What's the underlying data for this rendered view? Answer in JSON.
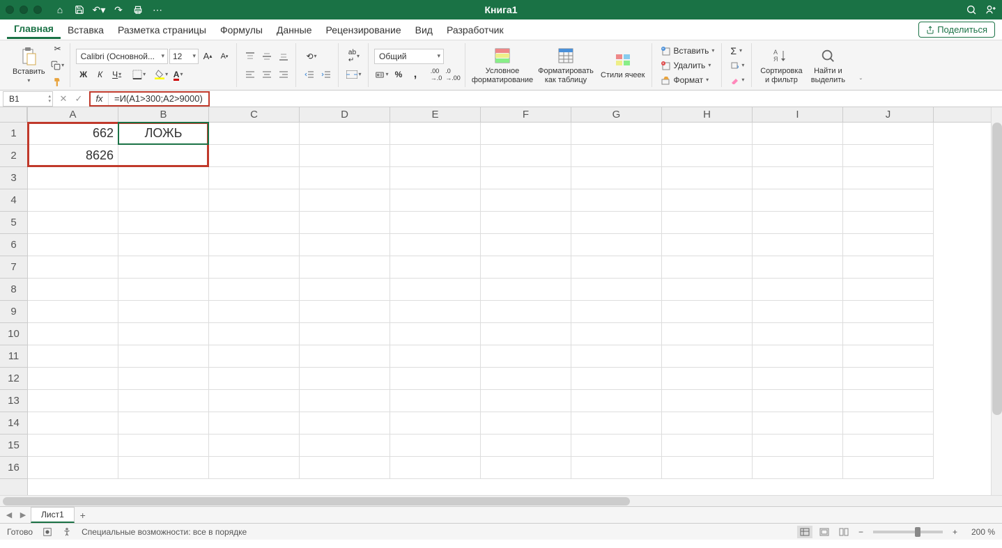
{
  "title": "Книга1",
  "tabs": [
    "Главная",
    "Вставка",
    "Разметка страницы",
    "Формулы",
    "Данные",
    "Рецензирование",
    "Вид",
    "Разработчик"
  ],
  "share": "Поделиться",
  "clipboard": {
    "paste": "Вставить"
  },
  "font": {
    "name": "Calibri (Основной...",
    "size": "12",
    "bold": "Ж",
    "italic": "К",
    "underline": "Ч"
  },
  "number_format": "Общий",
  "conditional": {
    "cond": "Условное форматирование",
    "table": "Форматировать как таблицу",
    "styles": "Стили ячеек"
  },
  "cells": {
    "insert": "Вставить",
    "delete": "Удалить",
    "format": "Формат"
  },
  "editing": {
    "sort": "Сортировка и фильтр",
    "find": "Найти и выделить"
  },
  "name_box": "B1",
  "formula": "=И(A1>300;A2>9000)",
  "columns": [
    "A",
    "B",
    "C",
    "D",
    "E",
    "F",
    "G",
    "H",
    "I",
    "J"
  ],
  "rows": [
    1,
    2,
    3,
    4,
    5,
    6,
    7,
    8,
    9,
    10,
    11,
    12,
    13,
    14,
    15,
    16
  ],
  "grid": {
    "A1": "662",
    "A2": "8626",
    "B1": "ЛОЖЬ"
  },
  "sheet": "Лист1",
  "status": {
    "ready": "Готово",
    "accessibility": "Специальные возможности: все в порядке",
    "zoom": "200 %"
  }
}
